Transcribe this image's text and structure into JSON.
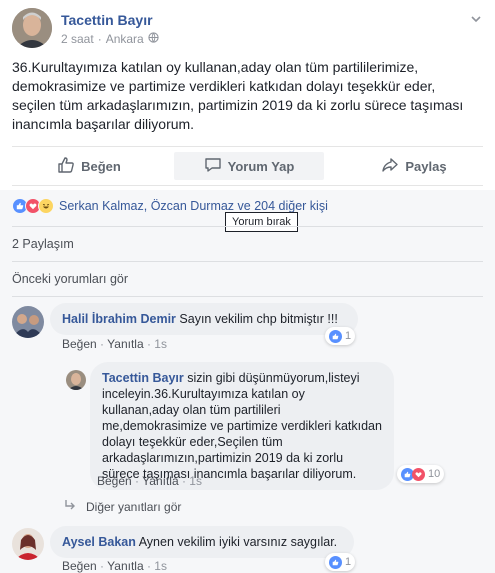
{
  "post": {
    "author": "Tacettin Bayır",
    "time": "2 saat",
    "location": "Ankara",
    "text": "36.Kurultayımıza katılan oy kullanan,aday olan tüm partililerimize, demokrasimize ve partimize verdikleri katkıdan dolayı teşekkür eder, seçilen tüm arkadaşlarımızın, partimizin 2019 da ki zorlu sürece taşıması inancımla başarılar diliyorum."
  },
  "actions": {
    "like": "Beğen",
    "comment": "Yorum Yap",
    "share": "Paylaş"
  },
  "reactions_summary": "Serkan Kalmaz, Özcan Durmaz ve 204 diğer kişi",
  "tooltip": "Yorum bırak",
  "shares": "2 Paylaşım",
  "previous_comments": "Önceki yorumları gör",
  "comments": [
    {
      "name": "Halil İbrahim Demir",
      "text": "Sayın vekilim chp bitmiştır !!!",
      "like": "Beğen",
      "reply": "Yanıtla",
      "time": "1s",
      "reaction_count": "1"
    },
    {
      "name": "Tacettin Bayır",
      "text": "sizin gibi düşünmüyorum,listeyi inceleyin.36.Kurultayımıza katılan oy kullanan,aday olan tüm partilileri me,demokrasimize ve partimize verdikleri katkıdan dolayı teşekkür eder,Seçilen tüm arkadaşlarımızın,partimizin 2019 da ki zorlu sürece taşıması inancımla başarılar diliyorum.",
      "like": "Beğen",
      "reply": "Yanıtla",
      "time": "1s",
      "reaction_count": "10"
    },
    {
      "name": "Aysel Bakan",
      "text": "Aynen vekilim iyiki varsınız saygılar.",
      "like": "Beğen",
      "reply": "Yanıtla",
      "time": "1s",
      "reaction_count": "1"
    }
  ],
  "more_replies": "Diğer yanıtları gör",
  "colors": {
    "link": "#365899",
    "like_blue": "#5890ff",
    "love_red": "#f25268",
    "haha_yellow": "#fcd561"
  }
}
